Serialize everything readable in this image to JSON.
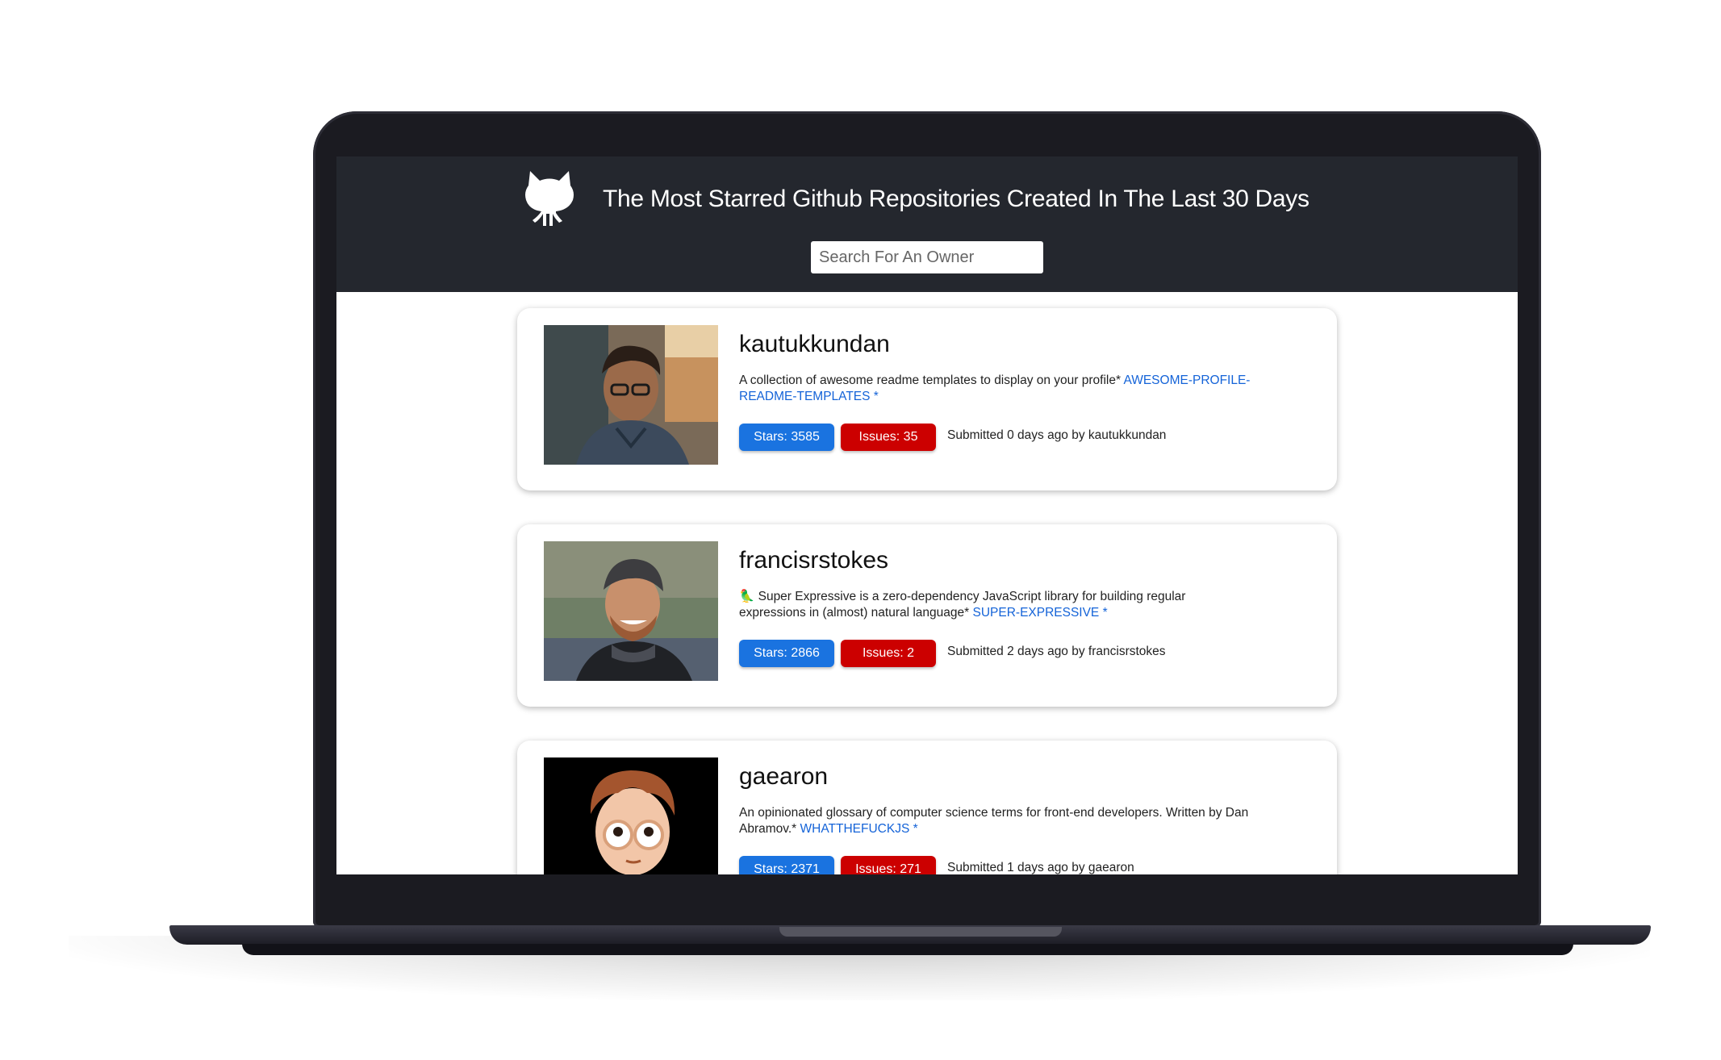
{
  "header": {
    "title": "The Most Starred Github Repositories Created In The Last 30 Days",
    "logo_icon": "github-octocat-icon",
    "search_placeholder": "Search For An Owner",
    "search_value": ""
  },
  "colors": {
    "header_bg": "#24272e",
    "stars_pill": "#1a73e0",
    "issues_pill": "#cc0000",
    "link": "#1463d8"
  },
  "repos": [
    {
      "owner": "kautukkundan",
      "description": "A collection of awesome readme templates to display on your profile*",
      "repo_name": "AWESOME-PROFILE-README-TEMPLATES *",
      "stars_label": "Stars: 3585",
      "issues_label": "Issues: 35",
      "submitted": "Submitted 0 days ago by kautukkundan"
    },
    {
      "owner": "francisrstokes",
      "description": "🦜 Super Expressive is a zero-dependency JavaScript library for building regular expressions in (almost) natural language*",
      "repo_name": "SUPER-EXPRESSIVE *",
      "stars_label": "Stars: 2866",
      "issues_label": "Issues: 2",
      "submitted": "Submitted 2 days ago by francisrstokes"
    },
    {
      "owner": "gaearon",
      "description": "An opinionated glossary of computer science terms for front-end developers. Written by Dan Abramov.*",
      "repo_name": "WHATTHEFUCKJS *",
      "stars_label": "Stars: 2371",
      "issues_label": "Issues: 271",
      "submitted": "Submitted 1 days ago by gaearon"
    }
  ]
}
